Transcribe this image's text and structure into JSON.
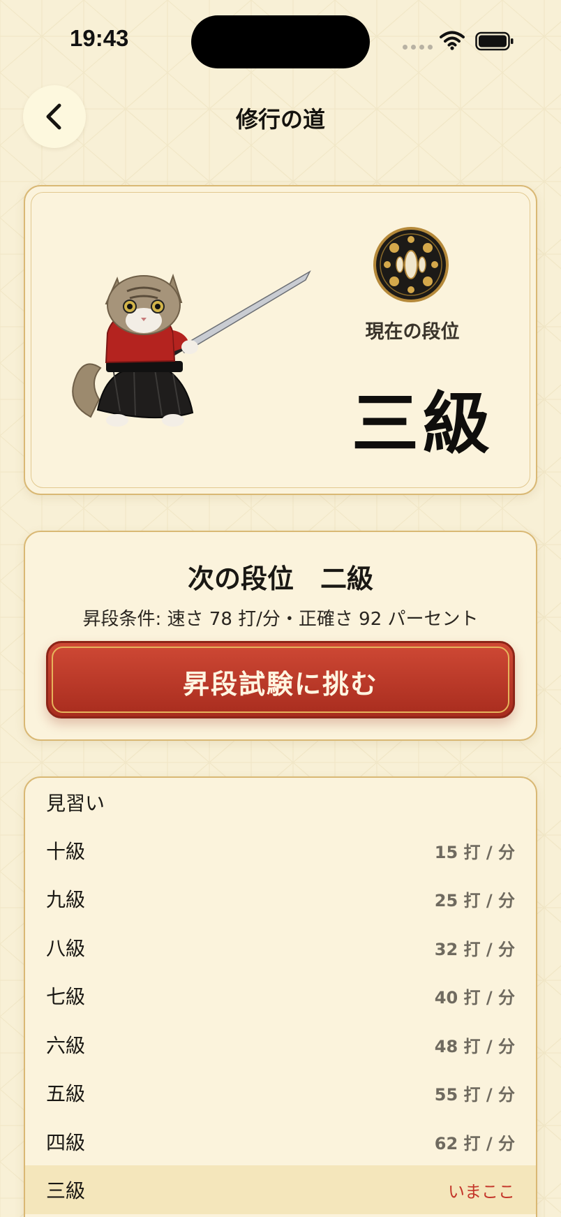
{
  "status": {
    "time": "19:43"
  },
  "header": {
    "title": "修行の道"
  },
  "rank_card": {
    "label": "現在の段位",
    "rank": "三級"
  },
  "next_card": {
    "title": "次の段位　二級",
    "condition": "昇段条件: 速さ 78 打/分・正確さ 92 パーセント",
    "button_label": "昇段試験に挑む"
  },
  "rank_list": {
    "rows": [
      {
        "name": "見習い",
        "speed": ""
      },
      {
        "name": "十級",
        "speed": "15 打 / 分"
      },
      {
        "name": "九級",
        "speed": "25 打 / 分"
      },
      {
        "name": "八級",
        "speed": "32 打 / 分"
      },
      {
        "name": "七級",
        "speed": "40 打 / 分"
      },
      {
        "name": "六級",
        "speed": "48 打 / 分"
      },
      {
        "name": "五級",
        "speed": "55 打 / 分"
      },
      {
        "name": "四級",
        "speed": "62 打 / 分"
      },
      {
        "name": "三級",
        "speed": "いまここ"
      }
    ]
  },
  "colors": {
    "background": "#f8f0d6",
    "accent_red": "#c4362a",
    "border_gold": "#d9b874"
  },
  "icons": {
    "back": "chevron-left-icon",
    "wifi": "wifi-icon",
    "battery": "battery-icon",
    "emblem": "tsuba-icon"
  }
}
